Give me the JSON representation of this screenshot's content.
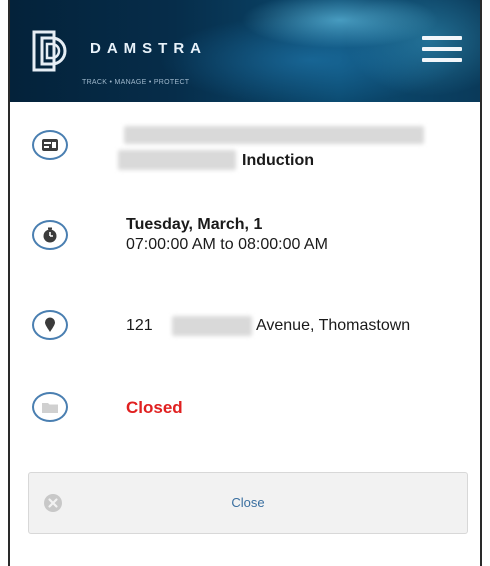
{
  "header": {
    "brand": "DAMSTRA",
    "tagline": "TRACK • MANAGE • PROTECT",
    "menu_icon": "hamburger-menu-icon"
  },
  "event": {
    "title_suffix": "Induction",
    "title_icon": "id-card-icon"
  },
  "schedule": {
    "date": "Tuesday, March, 1",
    "time": "07:00:00 AM to 08:00:00 AM",
    "icon": "clock-icon"
  },
  "location": {
    "number": "121",
    "suffix": "Avenue, Thomastown",
    "icon": "map-pin-icon"
  },
  "status": {
    "label": "Closed",
    "color": "#e02020",
    "icon": "folder-icon"
  },
  "actions": {
    "close_label": "Close",
    "close_icon": "circle-x-icon"
  }
}
